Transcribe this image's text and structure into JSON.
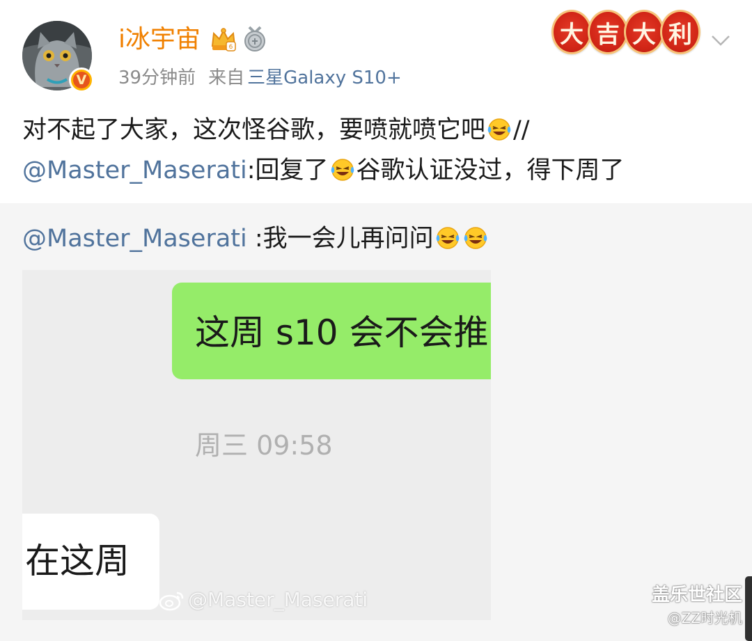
{
  "header": {
    "username": "i冰宇宙",
    "time": "39分钟前",
    "source_label": "来自",
    "device": "三星Galaxy S10+",
    "lucky_chars": [
      "大",
      "吉",
      "大",
      "利"
    ],
    "verified_mark": "V"
  },
  "post": {
    "line1": "对不起了大家，这次怪谷歌，要喷就喷它吧",
    "line1_tail": "//",
    "mention": "@Master_Maserati",
    "line2_a": ":回复了",
    "line2_b": "谷歌认证没过，得下周了"
  },
  "repost": {
    "mention": "@Master_Maserati",
    "text": " :我一会儿再问问"
  },
  "chat_image": {
    "sent_message": "这周 s10 会不会推",
    "timestamp": "周三 09:58",
    "received_message": "在这周",
    "weibo_watermark": "@Master_Maserati"
  },
  "watermark": {
    "brand": "盖乐世社区",
    "author": "@ZZ时光机"
  },
  "colors": {
    "username": "#f08000",
    "link": "#50739c",
    "meta": "#8a8a8a",
    "chat_green": "#95ec69",
    "repost_bg": "#f5f5f5"
  },
  "icons": [
    "cat-avatar",
    "verified-badge-icon",
    "crown-level-icon",
    "medal-icon",
    "chevron-down-icon",
    "laugh-cry-emoji-icon",
    "weibo-logo-icon"
  ]
}
